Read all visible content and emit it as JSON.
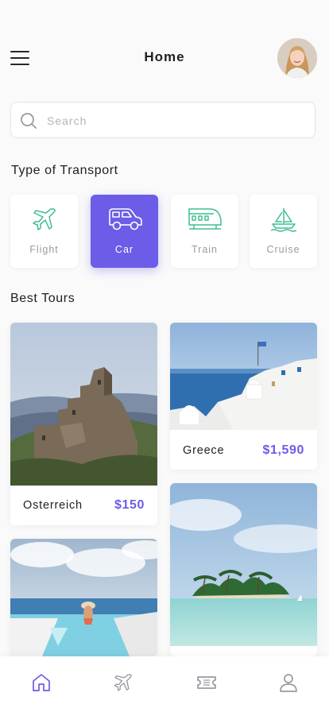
{
  "header": {
    "title": "Home",
    "menu_icon": "hamburger-menu-icon",
    "avatar_icon": "user-avatar"
  },
  "search": {
    "placeholder": "Search",
    "value": "",
    "icon": "search-icon"
  },
  "transport": {
    "title": "Type of Transport",
    "selected": "Car",
    "items": [
      {
        "label": "Flight",
        "icon": "airplane-icon"
      },
      {
        "label": "Car",
        "icon": "car-icon"
      },
      {
        "label": "Train",
        "icon": "train-icon"
      },
      {
        "label": "Cruise",
        "icon": "sailboat-icon"
      }
    ]
  },
  "tours": {
    "title": "Best Tours",
    "items": [
      {
        "name": "Osterreich",
        "price": "$150",
        "image": "castle-on-hill-photo"
      },
      {
        "name": "Greece",
        "price": "$1,590",
        "image": "santorini-white-houses-photo"
      },
      {
        "name": "",
        "price": "",
        "image": "infinity-pool-woman-hat-photo"
      },
      {
        "name": "",
        "price": "",
        "image": "tropical-palm-island-photo"
      }
    ]
  },
  "tabbar": {
    "active": "home",
    "items": [
      {
        "id": "home",
        "icon": "home-icon"
      },
      {
        "id": "flights",
        "icon": "airplane-icon"
      },
      {
        "id": "tickets",
        "icon": "ticket-icon"
      },
      {
        "id": "profile",
        "icon": "profile-icon"
      }
    ]
  },
  "colors": {
    "accent": "#6c5ce7",
    "icon_green": "#3fbf8f",
    "background": "#fafafa"
  }
}
